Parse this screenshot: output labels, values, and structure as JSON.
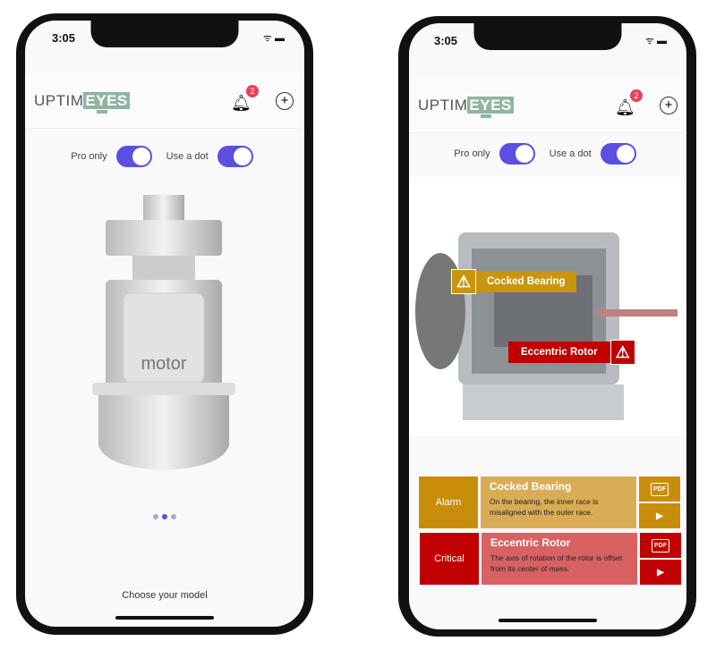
{
  "status": {
    "time": "3:05"
  },
  "brand": {
    "part1": "UPTIM",
    "part2": "EYES"
  },
  "notifications": {
    "count": "2"
  },
  "toggles": [
    {
      "label": "Pro only",
      "on": true
    },
    {
      "label": "Use a dot",
      "on": true
    }
  ],
  "left": {
    "model_label": "motor",
    "footer": "Choose your model",
    "pager": {
      "pages": 3,
      "active": 1
    }
  },
  "right": {
    "overlays": [
      {
        "label": "Cocked Bearing",
        "color": "#c9950f"
      },
      {
        "label": "Eccentric Rotor",
        "color": "#c00000"
      }
    ],
    "faults": [
      {
        "severity": "Alarm",
        "title": "Cocked Bearing",
        "description": "On the bearing, the inner race is misaligned with the outer race.",
        "severity_color": "#c98d0c",
        "desc_color": "#d9ac55",
        "pdf_label": "PDF"
      },
      {
        "severity": "Critical",
        "title": "Eccentric Rotor",
        "description": "The axis of rotation of the rotor is offset from its center of mass.",
        "severity_color": "#c00000",
        "desc_color": "#d86262",
        "pdf_label": "PDF"
      }
    ]
  }
}
